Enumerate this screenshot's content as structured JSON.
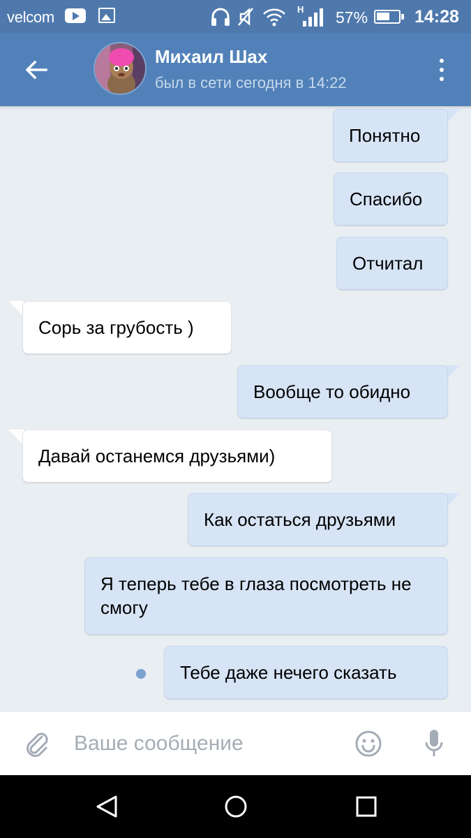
{
  "status_bar": {
    "carrier": "velcom",
    "network_type": "H",
    "battery_percent": "57%",
    "time": "14:28"
  },
  "header": {
    "contact_name": "Михаил Шах",
    "last_seen": "был в сети сегодня в 14:22"
  },
  "messages": [
    {
      "direction": "out",
      "text": "Понятно"
    },
    {
      "direction": "out",
      "text": "Спасибо"
    },
    {
      "direction": "out",
      "text": "Отчитал"
    },
    {
      "direction": "in",
      "text": "Сорь за грубость )"
    },
    {
      "direction": "out",
      "text": "Вообще то обидно"
    },
    {
      "direction": "in",
      "text": "Давай останемся друзьями)"
    },
    {
      "direction": "out",
      "text": "Как остаться друзьями"
    },
    {
      "direction": "out",
      "text": "Я теперь тебе в глаза посмотреть не смогу"
    },
    {
      "direction": "out",
      "text": "Тебе даже нечего сказать",
      "unread": true
    }
  ],
  "input": {
    "placeholder": "Ваше сообщение",
    "value": ""
  },
  "colors": {
    "header": "#5181b8",
    "status_bar": "#4f79ad",
    "background": "#e9eef3",
    "outgoing_bubble": "#d7e4f6",
    "incoming_bubble": "#ffffff"
  }
}
